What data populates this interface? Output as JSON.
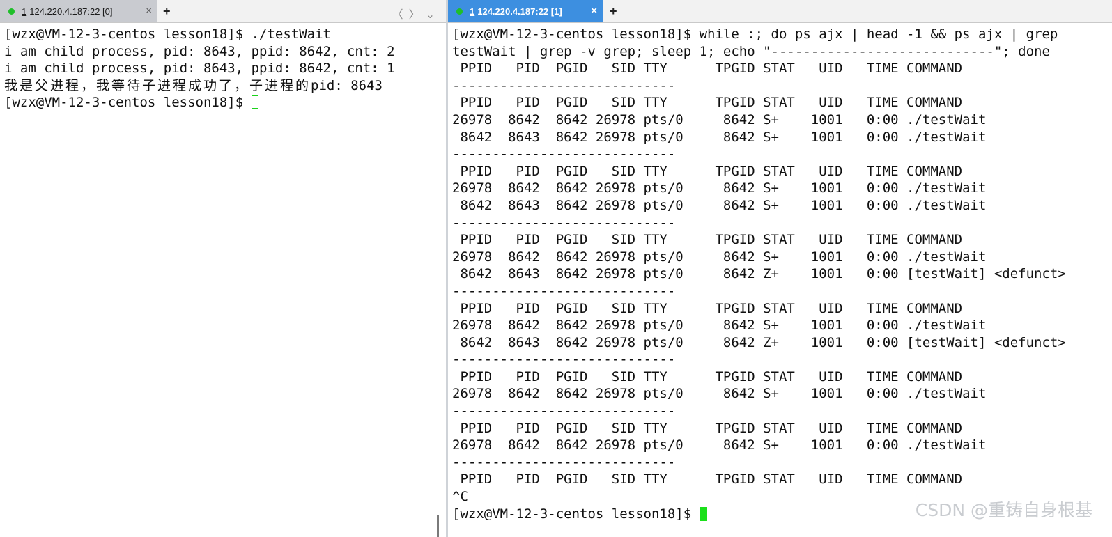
{
  "left_pane": {
    "tab": {
      "number": "1",
      "title": "124.220.4.187:22 [0]",
      "close": "×"
    },
    "new_tab": "+",
    "nav": {
      "prev": "〈",
      "next": "〉",
      "menu": "⌄"
    },
    "lines": [
      "[wzx@VM-12-3-centos lesson18]$ ./testWait",
      "i am child process, pid: 8643, ppid: 8642, cnt: 2",
      "i am child process, pid: 8643, ppid: 8642, cnt: 1"
    ],
    "cjk_line": {
      "cjk": "我是父进程，我等待子进程成功了，子进程的",
      "rest": "pid: 8643"
    },
    "prompt": "[wzx@VM-12-3-centos lesson18]$ "
  },
  "right_pane": {
    "tab": {
      "number": "1",
      "title": "124.220.4.187:22 [1]",
      "close": "×"
    },
    "new_tab": "+",
    "lines": [
      "[wzx@VM-12-3-centos lesson18]$ while :; do ps ajx | head -1 && ps ajx | grep",
      "testWait | grep -v grep; sleep 1; echo \"----------------------------\"; done",
      " PPID   PID  PGID   SID TTY      TPGID STAT   UID   TIME COMMAND",
      "----------------------------",
      " PPID   PID  PGID   SID TTY      TPGID STAT   UID   TIME COMMAND",
      "26978  8642  8642 26978 pts/0     8642 S+    1001   0:00 ./testWait",
      " 8642  8643  8642 26978 pts/0     8642 S+    1001   0:00 ./testWait",
      "----------------------------",
      " PPID   PID  PGID   SID TTY      TPGID STAT   UID   TIME COMMAND",
      "26978  8642  8642 26978 pts/0     8642 S+    1001   0:00 ./testWait",
      " 8642  8643  8642 26978 pts/0     8642 S+    1001   0:00 ./testWait",
      "----------------------------",
      " PPID   PID  PGID   SID TTY      TPGID STAT   UID   TIME COMMAND",
      "26978  8642  8642 26978 pts/0     8642 S+    1001   0:00 ./testWait",
      " 8642  8643  8642 26978 pts/0     8642 Z+    1001   0:00 [testWait] <defunct>",
      "----------------------------",
      " PPID   PID  PGID   SID TTY      TPGID STAT   UID   TIME COMMAND",
      "26978  8642  8642 26978 pts/0     8642 S+    1001   0:00 ./testWait",
      " 8642  8643  8642 26978 pts/0     8642 Z+    1001   0:00 [testWait] <defunct>",
      "----------------------------",
      " PPID   PID  PGID   SID TTY      TPGID STAT   UID   TIME COMMAND",
      "26978  8642  8642 26978 pts/0     8642 S+    1001   0:00 ./testWait",
      "----------------------------",
      " PPID   PID  PGID   SID TTY      TPGID STAT   UID   TIME COMMAND",
      "26978  8642  8642 26978 pts/0     8642 S+    1001   0:00 ./testWait",
      "----------------------------",
      " PPID   PID  PGID   SID TTY      TPGID STAT   UID   TIME COMMAND",
      "^C"
    ],
    "prompt": "[wzx@VM-12-3-centos lesson18]$ "
  },
  "watermark": "CSDN @重铸自身根基",
  "colors": {
    "active_tab_right": "#3d8fe0",
    "active_tab_left": "#c9cbd0",
    "status_dot": "#1fbf2a",
    "cursor": "#1be01b"
  }
}
